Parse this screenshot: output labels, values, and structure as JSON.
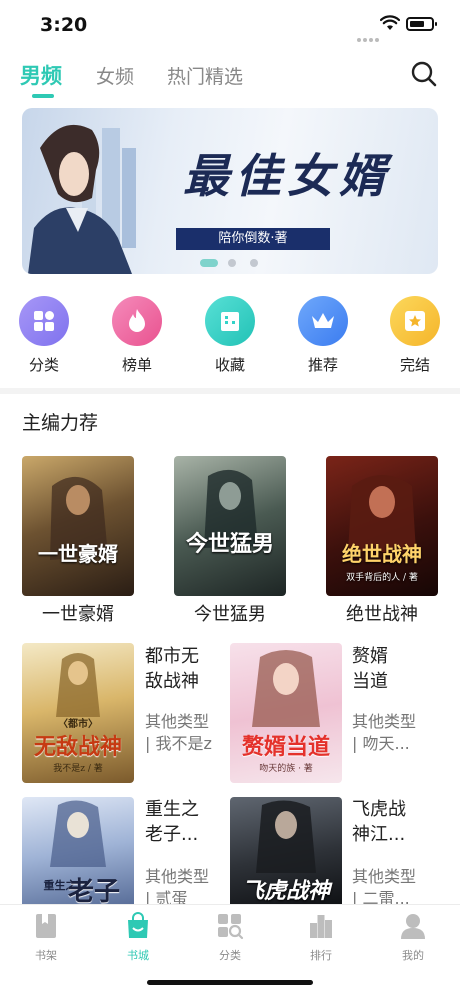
{
  "status": {
    "time": "3:20"
  },
  "tabs": [
    {
      "label": "男频",
      "active": true
    },
    {
      "label": "女频",
      "active": false
    },
    {
      "label": "热门精选",
      "active": false
    }
  ],
  "banner": {
    "title": "最佳女婿",
    "author": "陪你倒数·著",
    "page_count": 3,
    "active_page": 1
  },
  "categories": [
    {
      "label": "分类",
      "icon": "grid-icon",
      "color": "#8f83f2"
    },
    {
      "label": "榜单",
      "icon": "flame-icon",
      "color": "#ef6aa5"
    },
    {
      "label": "收藏",
      "icon": "building-icon",
      "color": "#34d3c8"
    },
    {
      "label": "推荐",
      "icon": "crown-icon",
      "color": "#4a8ff5"
    },
    {
      "label": "完结",
      "icon": "star-icon",
      "color": "#f8c93d"
    }
  ],
  "section": {
    "title": "主编力荐"
  },
  "grid_books": [
    {
      "title": "一世豪婿",
      "cover_text": "一世豪婿"
    },
    {
      "title": "今世猛男",
      "cover_text": "今世猛男"
    },
    {
      "title": "绝世战神",
      "cover_text": "绝世战神",
      "cover_sub": "双手背后的人 / 著"
    }
  ],
  "list_books": [
    {
      "title_line1": "都市无",
      "title_line2": "敌战神",
      "meta_line1": "其他类型",
      "meta_line2": "| 我不是z",
      "cover_text": "无敌战神",
      "cover_top": "〈都市〉",
      "cover_sub": "我不是z / 著"
    },
    {
      "title_line1": "赘婿",
      "title_line2": "当道",
      "meta_line1": "其他类型",
      "meta_line2": "| 吻天...",
      "cover_text": "赘婿当道",
      "cover_sub": "吻天的族 · 著"
    },
    {
      "title_line1": "重生之",
      "title_line2": "老子...",
      "meta_line1": "其他类型",
      "meta_line2": "| 贰蛋",
      "cover_text": "老子",
      "cover_top": "重生之"
    },
    {
      "title_line1": "飞虎战",
      "title_line2": "神江...",
      "meta_line1": "其他类型",
      "meta_line2": "| 二雷...",
      "cover_text": "飞虎战神"
    }
  ],
  "bottom_nav": [
    {
      "label": "书架",
      "icon": "bookshelf-icon",
      "active": false
    },
    {
      "label": "书城",
      "icon": "bag-icon",
      "active": true
    },
    {
      "label": "分类",
      "icon": "category-icon",
      "active": false
    },
    {
      "label": "排行",
      "icon": "ranking-icon",
      "active": false
    },
    {
      "label": "我的",
      "icon": "profile-icon",
      "active": false
    }
  ],
  "colors": {
    "accent": "#2ec9b4",
    "text": "#222222",
    "muted": "#888888"
  }
}
